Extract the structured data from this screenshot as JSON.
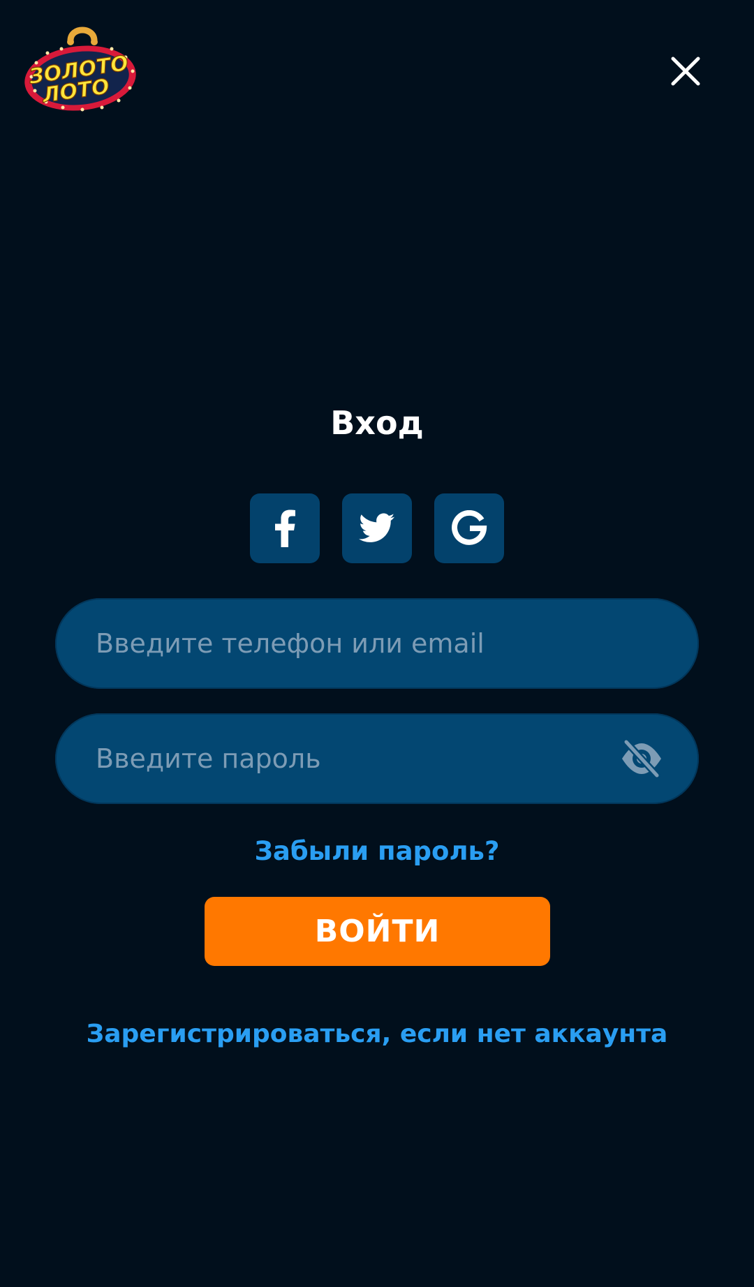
{
  "header": {
    "logo_text": "ЗОЛОТО ЛОТО",
    "close_icon": "close-icon"
  },
  "login": {
    "title": "Вход",
    "social": [
      {
        "icon": "facebook-icon"
      },
      {
        "icon": "twitter-icon"
      },
      {
        "icon": "google-icon"
      }
    ],
    "login_field": {
      "value": "",
      "placeholder": "Введите телефон или email"
    },
    "password_field": {
      "value": "",
      "placeholder": "Введите пароль",
      "toggle_icon": "eye-off-icon"
    },
    "forgot_label": "Забыли пароль?",
    "submit_label": "ВОЙТИ",
    "register_label": "Зарегистрироваться, если нет аккаунта"
  },
  "colors": {
    "background": "#010f1c",
    "field": "#034772",
    "social_button": "#03426c",
    "accent_orange": "#ff7800",
    "link_blue": "#2a9ef2",
    "placeholder": "#7d9cb5"
  }
}
